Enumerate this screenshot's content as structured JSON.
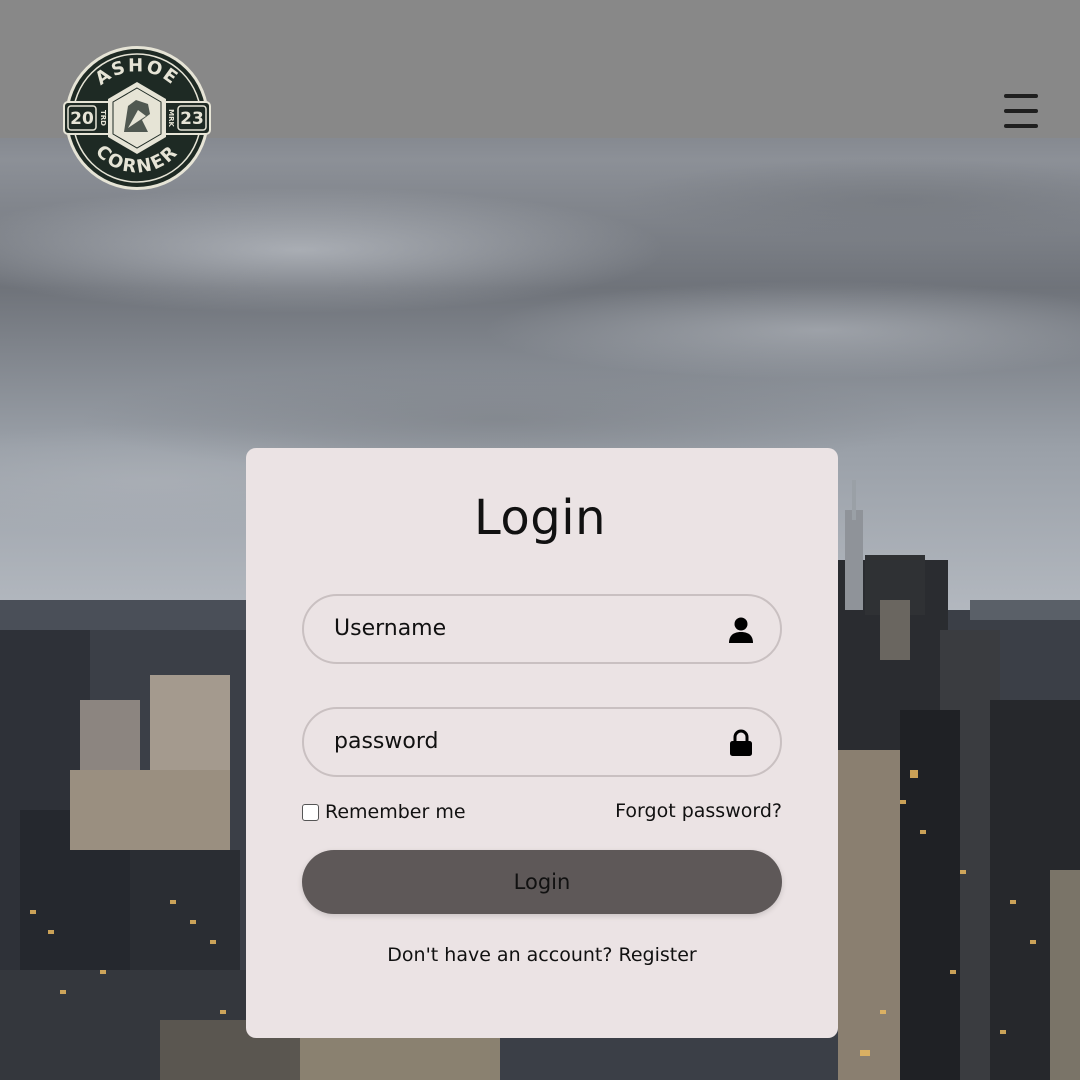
{
  "header": {
    "logo_text_top": "ASHOE",
    "logo_text_bottom": "CORNER",
    "logo_year_left": "20",
    "logo_year_right": "23",
    "logo_side_left": "TRD",
    "logo_side_right": "MRK",
    "menu_icon": "hamburger-menu-icon"
  },
  "login_form": {
    "title": "Login",
    "username": {
      "value": "Username",
      "icon": "user-icon"
    },
    "password": {
      "value": "password",
      "icon": "lock-icon"
    },
    "remember_label": "Remember me",
    "remember_checked": false,
    "forgot_label": "Forgot password?",
    "submit_label": "Login",
    "register_prompt": "Don't have an account?",
    "register_link": "Register"
  },
  "colors": {
    "header_bg": "#888888",
    "card_bg": "#ebe3e4",
    "button_bg": "#5e5858",
    "logo_dark": "#1e2a24",
    "logo_light": "#e6e4d6"
  }
}
